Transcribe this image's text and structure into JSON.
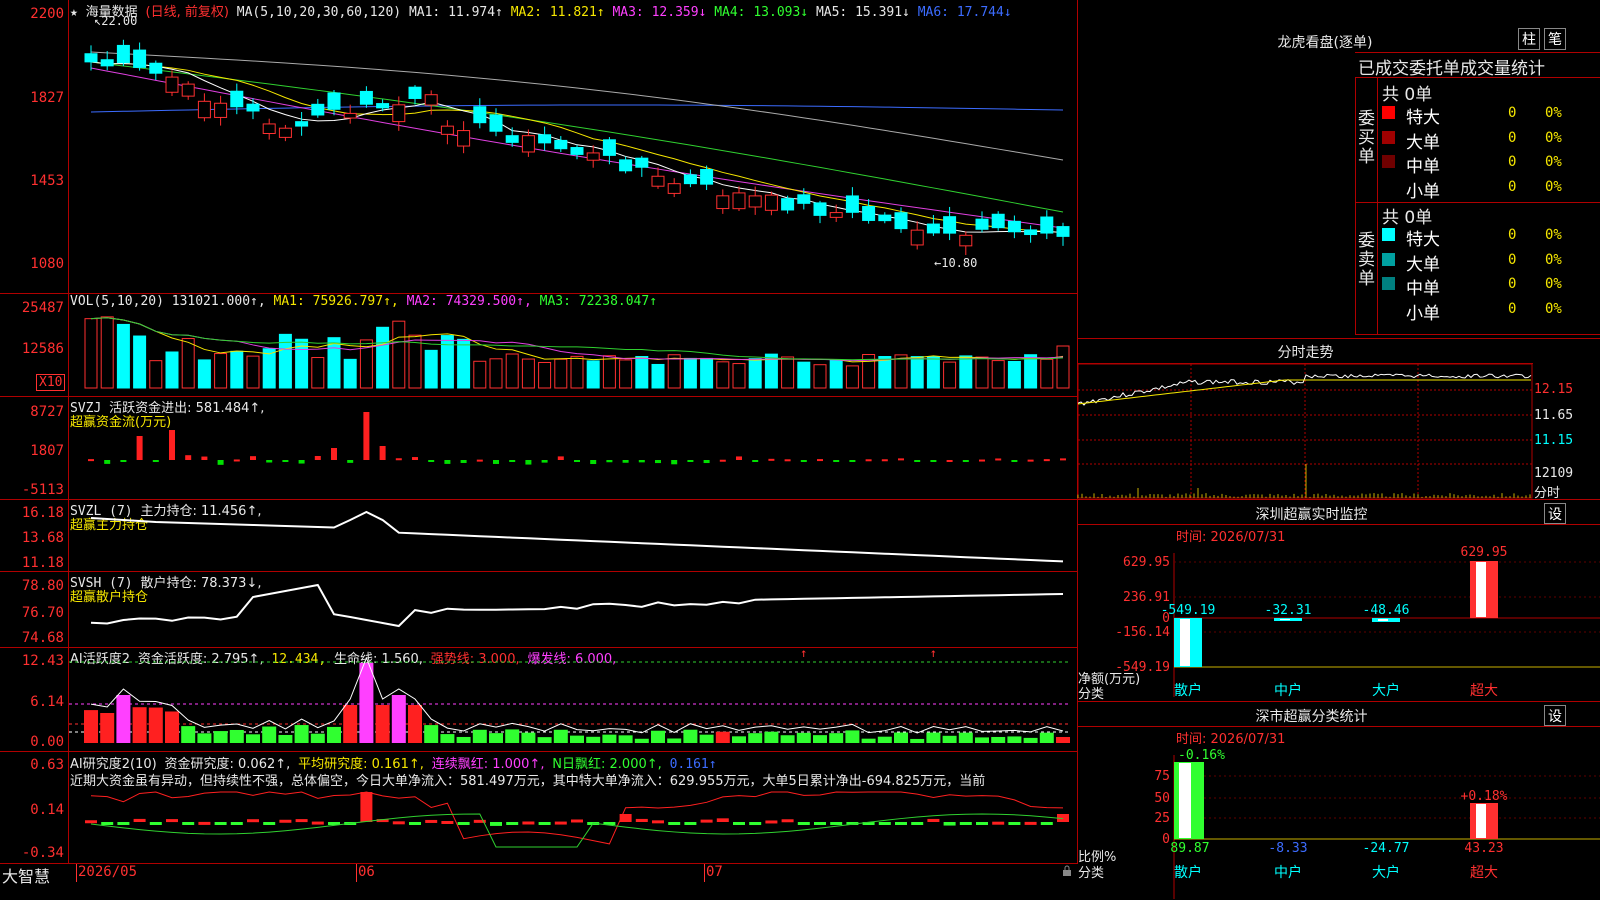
{
  "main": {
    "header": {
      "star": "★",
      "stock": "海量数据",
      "period": "(日线, 前复权)",
      "ma_params": "MA(5,10,20,30,60,120)",
      "ma1": "MA1: 11.974↑",
      "ma2": "MA2: 11.821↑",
      "ma3": "MA3: 12.359↓",
      "ma4": "MA4: 13.093↓",
      "ma5": "MA5: 15.391↓",
      "ma6": "MA6: 17.744↓"
    },
    "y_labels": [
      "2200",
      "1827",
      "1453",
      "1080"
    ],
    "high_marker": "22.00",
    "low_marker": "10.80"
  },
  "vol": {
    "header": {
      "name": "VOL(5,10,20)",
      "value": "131021.000↑,",
      "ma1": "MA1: 75926.797↑,",
      "ma2": "MA2: 74329.500↑,",
      "ma3": "MA3: 72238.047↑"
    },
    "y_labels": [
      "25487",
      "12586"
    ],
    "unit": "X10"
  },
  "svzj": {
    "header": {
      "name": "SVZJ",
      "label": "活跃资金进出: 581.484↑,",
      "sub": "超赢资金流(万元)"
    },
    "y_labels": [
      "8727",
      "1807",
      "-5113"
    ]
  },
  "svzl": {
    "header": {
      "name": "SVZL (7)",
      "label": "主力持仓: 11.456↑,",
      "sub": "超赢主力持仓"
    },
    "y_labels": [
      "16.18",
      "13.68",
      "11.18"
    ]
  },
  "svsh": {
    "header": {
      "name": "SVSH (7)",
      "label": "散户持仓: 78.373↓,",
      "sub": "超赢散户持仓"
    },
    "y_labels": [
      "78.80",
      "76.70",
      "74.68"
    ]
  },
  "ai1": {
    "header": {
      "name": "AI活跃度2",
      "a": "资金活跃度: 2.795↑,",
      "b": "12.434,",
      "c": "生命线: 1.560,",
      "d": "强势线: 3.000,",
      "e": "爆发线: 6.000,"
    },
    "y_labels": [
      "12.43",
      "6.14",
      "0.00"
    ]
  },
  "ai2": {
    "header": {
      "name": "AI研究度2(10)",
      "a": "资金研究度: 0.062↑,",
      "b": "平均研究度: 0.161↑,",
      "c": "连续飘红: 1.000↑,",
      "d": "N日飘红: 2.000↑,",
      "e": "0.161↑"
    },
    "comment": "近期大资金虽有异动，但持续性不强，总体偏空，今日大单净流入：581.497万元，其中特大单净流入：629.955万元，大单5日累计净出-694.825万元，当前",
    "y_labels": [
      "0.63",
      "0.14",
      "-0.34"
    ]
  },
  "bottom": {
    "brand": "大智慧",
    "dates": [
      "2026/05",
      "06",
      "07"
    ]
  },
  "right": {
    "lhb": {
      "title": "龙虎看盘(逐单)",
      "btn1": "柱",
      "btn2": "笔",
      "subtitle": "已成交委托单成交量统计",
      "buy_label": "委买单",
      "sell_label": "委卖单",
      "buy_total": "共 0单",
      "sell_total": "共 0单",
      "buy_rows": [
        {
          "name": "特大",
          "v": "0",
          "p": "0%",
          "color": "#ff0000"
        },
        {
          "name": "大单",
          "v": "0",
          "p": "0%",
          "color": "#a00000"
        },
        {
          "name": "中单",
          "v": "0",
          "p": "0%",
          "color": "#700000"
        },
        {
          "name": "小单",
          "v": "0",
          "p": "0%",
          "color": "#000000"
        }
      ],
      "sell_rows": [
        {
          "name": "特大",
          "v": "0",
          "p": "0%",
          "color": "#00ffff"
        },
        {
          "name": "大单",
          "v": "0",
          "p": "0%",
          "color": "#00a0a0"
        },
        {
          "name": "中单",
          "v": "0",
          "p": "0%",
          "color": "#008080"
        },
        {
          "name": "小单",
          "v": "0",
          "p": "0%",
          "color": "#000000"
        }
      ]
    },
    "fs": {
      "title": "分时走势",
      "y_labels": [
        "12.15",
        "11.65",
        "11.15",
        "12109"
      ],
      "unit": "分时"
    },
    "monitor": {
      "title": "深圳超赢实时监控",
      "btn": "设",
      "time": "时间: 2026/07/31",
      "y_labels": [
        "629.95",
        "236.91",
        "0",
        "-156.14",
        "-549.19"
      ],
      "bar_labels": [
        "-549.19",
        "-32.31",
        "-48.46",
        "629.95"
      ],
      "left_label1": "净额(万元)",
      "left_label2": "分类",
      "cats": [
        "散户",
        "中户",
        "大户",
        "超大"
      ]
    },
    "class": {
      "title": "深市超赢分类统计",
      "btn": "设",
      "time": "时间: 2026/07/31",
      "y_labels": [
        "75",
        "50",
        "25",
        "0"
      ],
      "top_labels": [
        "-0.16%",
        "+0.18%"
      ],
      "values": [
        "89.87",
        "-8.33",
        "-24.77",
        "43.23"
      ],
      "left_label1": "比例%",
      "left_label2": "分类",
      "cats": [
        "散户",
        "中户",
        "大户",
        "超大"
      ]
    }
  }
}
